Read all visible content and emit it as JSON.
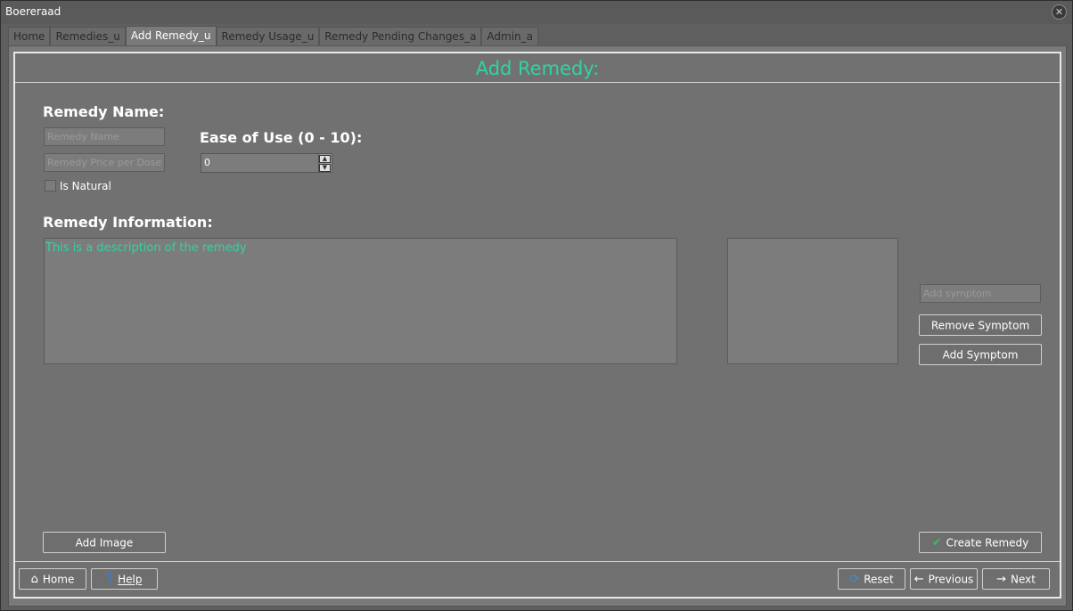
{
  "window": {
    "title": "Boereraad"
  },
  "tabs": [
    {
      "label": "Home",
      "active": false
    },
    {
      "label": "Remedies_u",
      "active": false
    },
    {
      "label": "Add Remedy_u",
      "active": true
    },
    {
      "label": "Remedy Usage_u",
      "active": false
    },
    {
      "label": "Remedy Pending Changes_a",
      "active": false
    },
    {
      "label": "Admin_a",
      "active": false
    }
  ],
  "page": {
    "title": "Add Remedy:"
  },
  "form": {
    "remedy_name_label": "Remedy Name:",
    "remedy_name_placeholder": "Remedy Name",
    "remedy_price_placeholder": "Remedy Price per Dose",
    "ease_label": "Ease of Use (0 - 10):",
    "ease_value": "0",
    "is_natural_label": "Is Natural",
    "is_natural_checked": false,
    "info_label": "Remedy Information:",
    "info_text": "This is a description of the remedy",
    "symptom_placeholder": "Add symptom",
    "remove_symptom_label": "Remove Symptom",
    "add_symptom_label": "Add Symptom",
    "add_image_label": "Add Image",
    "create_remedy_label": "Create Remedy"
  },
  "footer": {
    "home_label": "Home",
    "help_label": "Help",
    "reset_label": "Reset",
    "previous_label": "Previous",
    "next_label": "Next"
  },
  "colors": {
    "accent": "#2fd4a4",
    "background": "#717171",
    "help_icon": "#2f7fd8",
    "reset_icon": "#3a8fe0",
    "check_icon": "#3fb86a"
  },
  "icons": {
    "home": "home-icon",
    "help": "question-icon",
    "reset": "refresh-icon",
    "previous": "arrow-left-icon",
    "next": "arrow-right-icon",
    "create": "checkmark-icon"
  }
}
